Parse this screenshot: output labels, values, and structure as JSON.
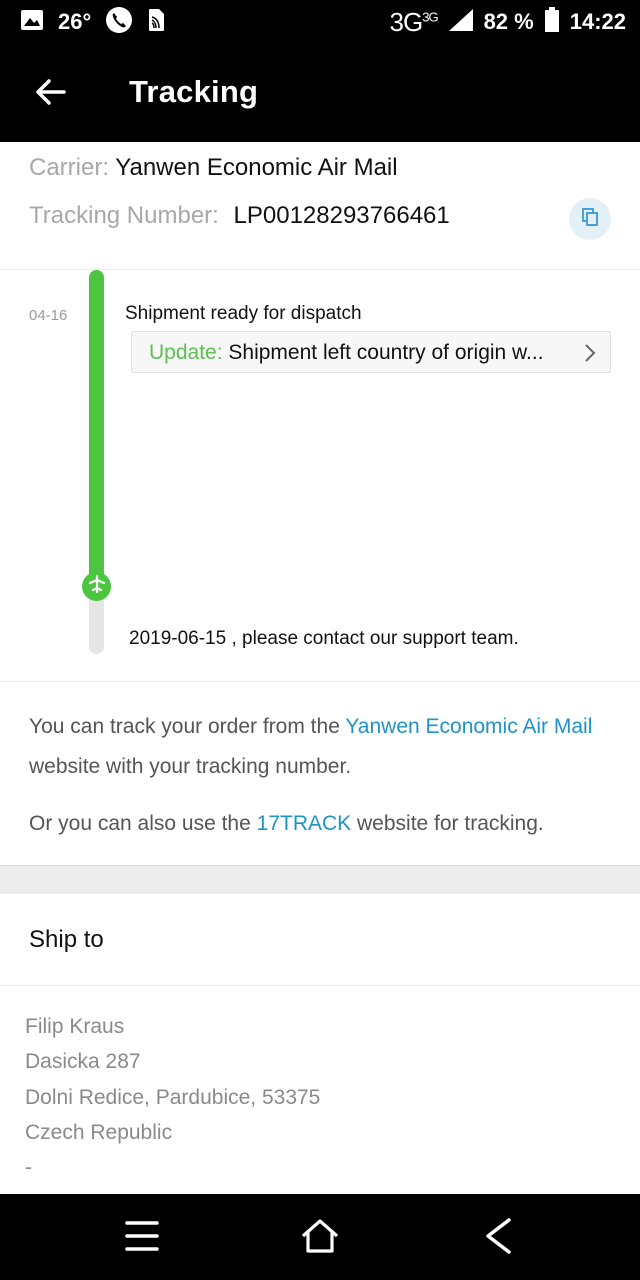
{
  "status_bar": {
    "temperature": "26°",
    "network": "3G",
    "network_sup": "3G",
    "battery": "82 %",
    "time": "14:22"
  },
  "app_bar": {
    "title": "Tracking"
  },
  "carrier": {
    "carrier_label": "Carrier:",
    "carrier_value": "Yanwen Economic Air Mail",
    "tracking_label": "Tracking Number:",
    "tracking_value": "LP00128293766461"
  },
  "timeline": {
    "date": "04-16",
    "event": "Shipment ready for dispatch",
    "update_label": "Update:",
    "update_text": "Shipment left country of origin w...",
    "note": "2019-06-15 , please contact our support team.",
    "progress_fraction": 0.83,
    "colors": {
      "accent": "#4cc641",
      "track": "#e6e6e6"
    }
  },
  "info": {
    "p1_before": "You can track your order from the ",
    "p1_link": "Yanwen Economic Air Mail",
    "p1_after": " website with your tracking number.",
    "p2_before": "Or you can also use the ",
    "p2_link": "17TRACK",
    "p2_after": " website for tracking.",
    "link_color": "#1e93c8"
  },
  "ship_to": {
    "title": "Ship to",
    "lines": [
      "Filip Kraus",
      "Dasicka 287",
      "Dolni Redice, Pardubice, 53375",
      "Czech Republic",
      "-"
    ]
  },
  "icons": {
    "back": "arrow-left-icon",
    "copy": "copy-icon",
    "timeline_node": "plane-icon",
    "update_chevron": "chevron-right-icon",
    "nav": [
      "menu-icon",
      "home-icon",
      "back-chevron-icon"
    ]
  }
}
